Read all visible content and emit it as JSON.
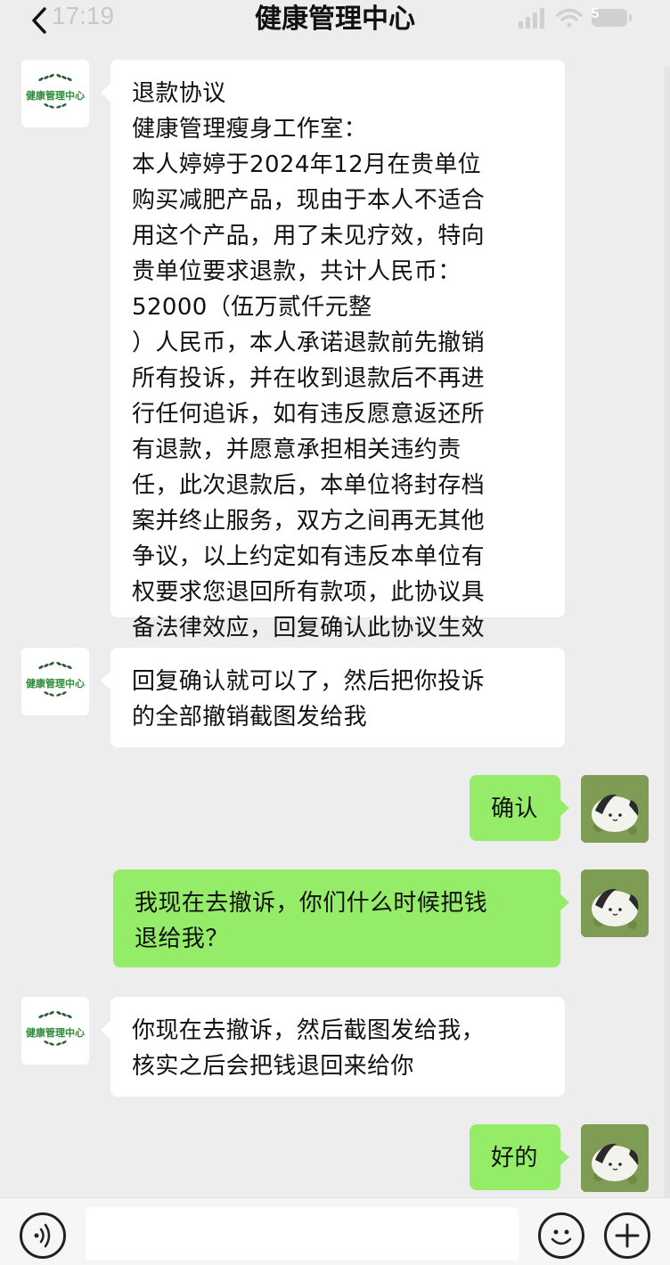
{
  "status_bar": {
    "time": "17:19",
    "battery": "5"
  },
  "header": {
    "title": "健康管理中心"
  },
  "contact": {
    "avatar_text": "健康管理中心"
  },
  "messages": [
    {
      "lines": [
        "退款协议",
        "健康管理瘦身工作室：",
        "本人婷婷于2024年12月在贵单位",
        "购买减肥产品，现由于本人不适合",
        "用这个产品，用了未见疗效，特向",
        "贵单位要求退款，共计人民币：",
        "52000（伍万贰仟元整",
        "）人民币，本人承诺退款前先撤销",
        "所有投诉，并在收到退款后不再进",
        "行任何追诉，如有违反愿意返还所",
        "有退款，并愿意承担相关违约责",
        "任，此次退款后，本单位将封存档",
        "案并终止服务，双方之间再无其他",
        "争议，以上约定如有违反本单位有",
        "权要求您退回所有款项，此协议具",
        "备法律效应，回复确认此协议生效"
      ]
    },
    {
      "lines": [
        "回复确认就可以了，然后把你投诉",
        "的全部撤销截图发给我"
      ]
    },
    {
      "lines": [
        "确认"
      ]
    },
    {
      "lines": [
        "我现在去撤诉，你们什么时候把钱",
        "退给我？"
      ]
    },
    {
      "lines": [
        "你现在去撤诉，然后截图发给我，",
        "核实之后会把钱退回来给你"
      ]
    },
    {
      "lines": [
        "好的"
      ]
    }
  ],
  "colors": {
    "incoming_bubble": "#ffffff",
    "outgoing_bubble": "#95ec69",
    "background": "#ededed"
  }
}
